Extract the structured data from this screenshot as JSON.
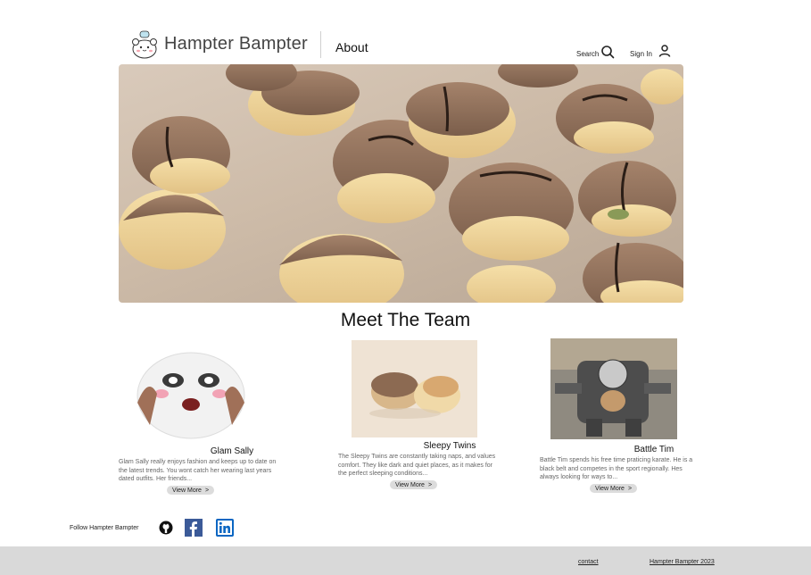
{
  "header": {
    "brand": "Hampter Bampter",
    "nav_about": "About",
    "search_label": "Search",
    "signin_label": "Sign In"
  },
  "team": {
    "title": "Meet The Team",
    "members": [
      {
        "name": "Glam Sally",
        "description": "Glam Sally really enjoys fashion and keeps up to date on the latest trends. You wont catch her wearing last years dated outfits. Her friends...",
        "button": "View More",
        "chevron": ">"
      },
      {
        "name": "Sleepy Twins",
        "description": "The Sleepy Twins are constantly taking naps, and values comfort. They like dark and quiet places, as it makes for the perfect sleeping conditions...",
        "button": "View More",
        "chevron": ">"
      },
      {
        "name": "Battle Tim",
        "description": "Battle Tim spends his free time praticing karate. He is a black belt and competes in the sport regionally. Hes always looking for ways to...",
        "button": "View More",
        "chevron": ">"
      }
    ]
  },
  "social": {
    "follow_label": "Follow Hampter Bampter",
    "icons": [
      "github-icon",
      "facebook-icon",
      "linkedin-icon"
    ]
  },
  "footer": {
    "contact": "contact",
    "copyright": "Hampter Bampter 2023"
  }
}
